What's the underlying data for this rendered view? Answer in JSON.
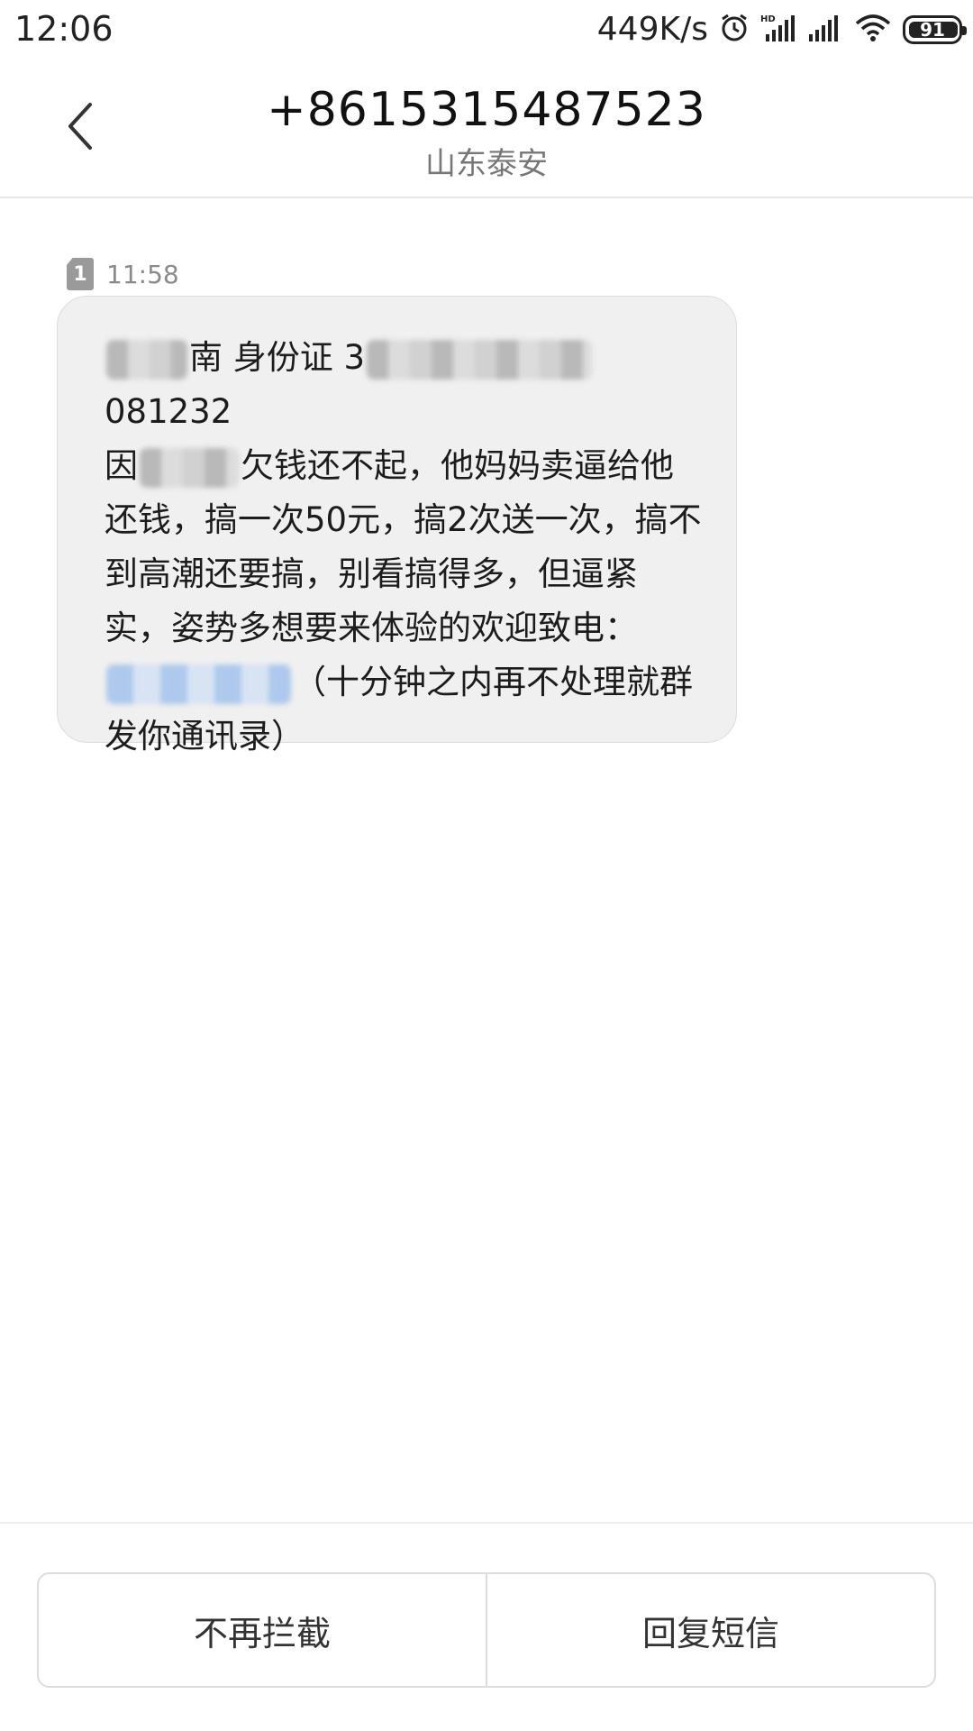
{
  "status_bar": {
    "time": "12:06",
    "net_speed": "449K/s",
    "battery": "91",
    "icons": [
      "alarm-icon",
      "hd-signal-icon",
      "signal-icon",
      "wifi-icon",
      "battery-icon"
    ]
  },
  "header": {
    "title": "+8615315487523",
    "subtitle": "山东泰安"
  },
  "message": {
    "sim": "1",
    "time": "11:58",
    "text_parts": {
      "p1": "身份证 3",
      "p2": "081232\n因",
      "p3": "欠钱还不起，他妈妈卖逼给他还钱，搞一次50元，搞2次送一次，搞不到高潮还要搞，别看搞得多，但逼紧实，姿势多想要来体验的欢迎致电：\n",
      "p4": "（十分钟之内再不处理就群发你通讯录）"
    }
  },
  "actions": {
    "unblock": "不再拦截",
    "reply": "回复短信"
  },
  "colors": {
    "bubble_bg": "#f0f0f0",
    "subtitle": "#777777",
    "divider": "#e6e6e6"
  }
}
